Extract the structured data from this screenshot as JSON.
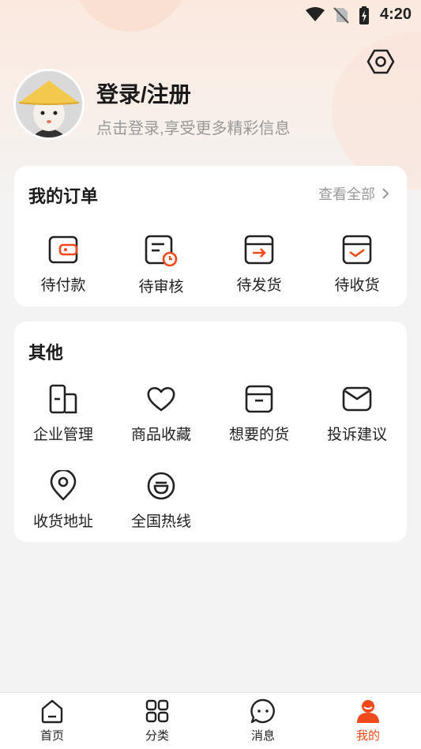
{
  "status_bar": {
    "time": "4:20"
  },
  "profile": {
    "title": "登录/注册",
    "subtitle": "点击登录,享受更多精彩信息"
  },
  "orders": {
    "title": "我的订单",
    "view_all": "查看全部",
    "items": [
      {
        "label": "待付款",
        "icon": "wallet-icon"
      },
      {
        "label": "待审核",
        "icon": "review-clock-icon"
      },
      {
        "label": "待发货",
        "icon": "box-arrow-icon"
      },
      {
        "label": "待收货",
        "icon": "box-check-icon"
      }
    ]
  },
  "other": {
    "title": "其他",
    "items": [
      {
        "label": "企业管理",
        "icon": "building-icon"
      },
      {
        "label": "商品收藏",
        "icon": "heart-icon"
      },
      {
        "label": "想要的货",
        "icon": "archive-box-icon"
      },
      {
        "label": "投诉建议",
        "icon": "envelope-icon"
      },
      {
        "label": "收货地址",
        "icon": "location-pin-icon"
      },
      {
        "label": "全国热线",
        "icon": "hotline-face-icon"
      }
    ]
  },
  "tabbar": {
    "items": [
      {
        "label": "首页",
        "icon": "home-icon"
      },
      {
        "label": "分类",
        "icon": "grid-icon"
      },
      {
        "label": "消息",
        "icon": "chat-icon"
      },
      {
        "label": "我的",
        "icon": "user-icon"
      }
    ]
  },
  "colors": {
    "accent": "#f04a1c",
    "text": "#222222",
    "muted": "#999999"
  }
}
